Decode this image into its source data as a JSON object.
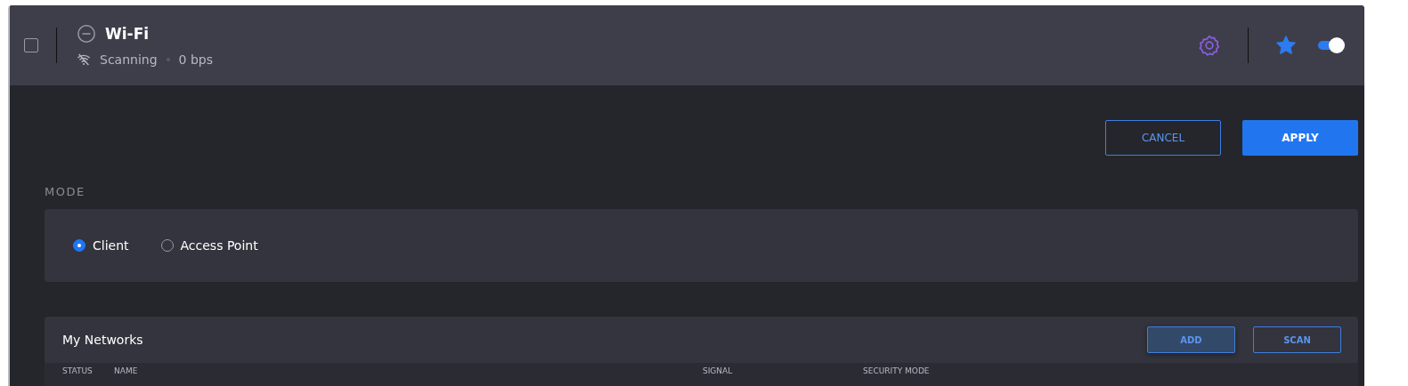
{
  "header": {
    "checked": false,
    "title": "Wi-Fi",
    "status": "Scanning",
    "rate": "0 bps",
    "favorite": true,
    "enabled": true
  },
  "actions": [
    {
      "label": "CANCEL",
      "kind": "outline"
    },
    {
      "label": "APPLY",
      "kind": "primary"
    }
  ],
  "mode": {
    "label": "MODE",
    "options": [
      {
        "label": "Client",
        "selected": true
      },
      {
        "label": "Access Point",
        "selected": false
      }
    ]
  },
  "networks": {
    "title": "My Networks",
    "buttons": [
      {
        "label": "ADD",
        "hovered": true
      },
      {
        "label": "SCAN",
        "hovered": false
      }
    ],
    "columns": [
      "STATUS",
      "NAME",
      "SIGNAL",
      "SECURITY MODE"
    ]
  }
}
